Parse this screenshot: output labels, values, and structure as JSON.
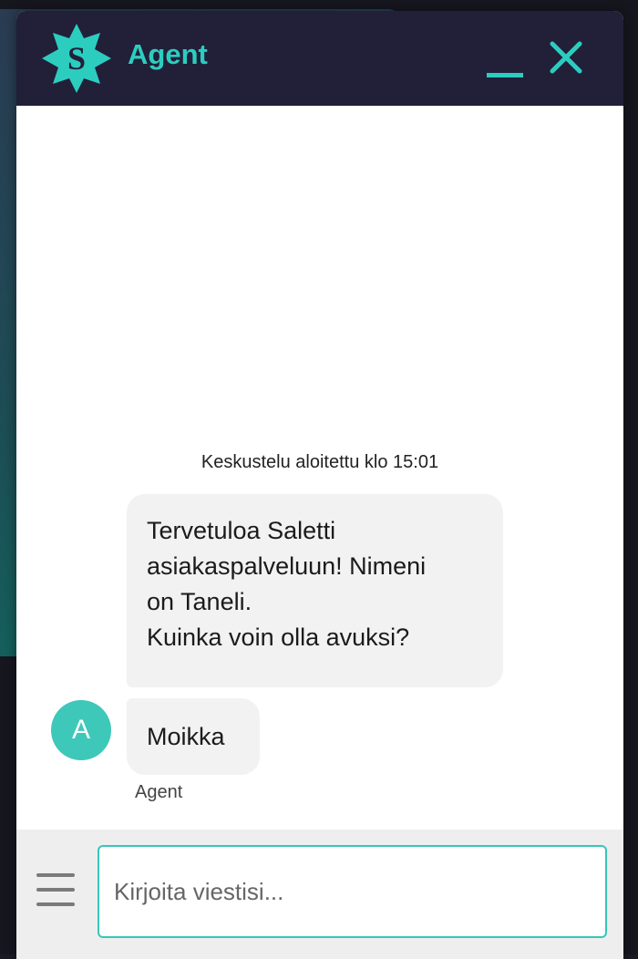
{
  "backdrop": {},
  "header": {
    "title": "Agent",
    "logo_icon": "saletti-logo-icon",
    "minimize_icon": "minimize-icon",
    "close_icon": "close-icon"
  },
  "conversation": {
    "started_text": "Keskustelu aloitettu klo 15:01",
    "messages": [
      {
        "lines": [
          "Tervetuloa Saletti",
          "asiakaspalveluun! Nimeni",
          "on Taneli.",
          "Kuinka voin olla avuksi?"
        ]
      },
      {
        "text": "Moikka",
        "avatar_letter": "A",
        "sender": "Agent"
      }
    ]
  },
  "composer": {
    "menu_icon": "hamburger-menu-icon",
    "input_placeholder": "Kirjoita viestisi...",
    "input_value": ""
  },
  "colors": {
    "header_bg": "#221f39",
    "accent": "#2ccdbf",
    "avatar_bg": "#3ec8b9",
    "bubble_bg": "#f2f2f2",
    "composer_bg": "#eeeeee"
  }
}
